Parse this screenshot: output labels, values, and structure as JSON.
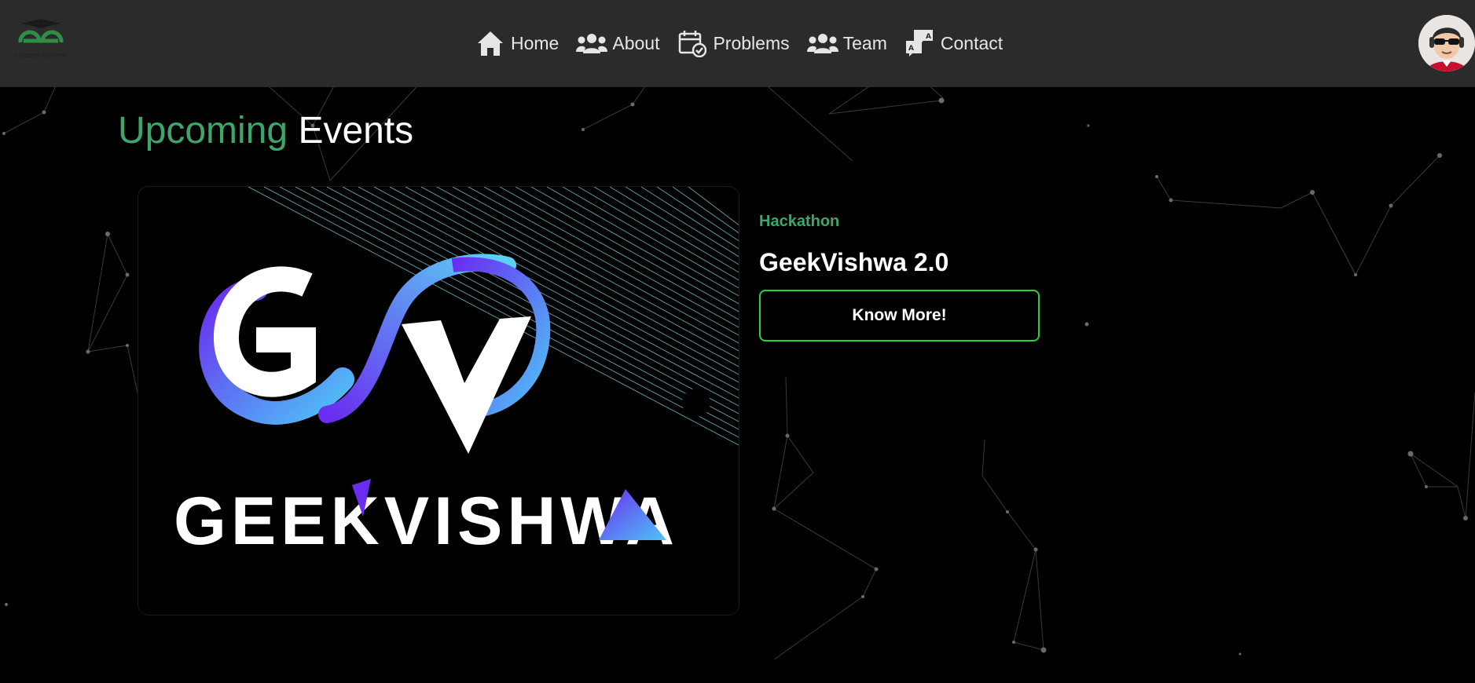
{
  "navbar": {
    "logo_text": "STUDENT CHAPTER",
    "items": [
      {
        "label": "Home",
        "icon": "home-icon"
      },
      {
        "label": "About",
        "icon": "users-icon"
      },
      {
        "label": "Problems",
        "icon": "calendar-check-icon"
      },
      {
        "label": "Team",
        "icon": "users-icon"
      },
      {
        "label": "Contact",
        "icon": "chat-icon"
      }
    ],
    "avatar_icon": "user-avatar"
  },
  "section": {
    "title_accent": "Upcoming",
    "title_rest": "Events"
  },
  "event": {
    "image_logo_text": "GEEKVISHWA",
    "category": "Hackathon",
    "title": "GeekVishwa 2.0",
    "button_label": "Know More!"
  },
  "colors": {
    "navbar_bg": "#2b2b2b",
    "accent_green": "#3fa56b",
    "button_border": "#22d43a",
    "logo_purple": "#6a2cf0",
    "logo_cyan": "#4fc3f7"
  }
}
